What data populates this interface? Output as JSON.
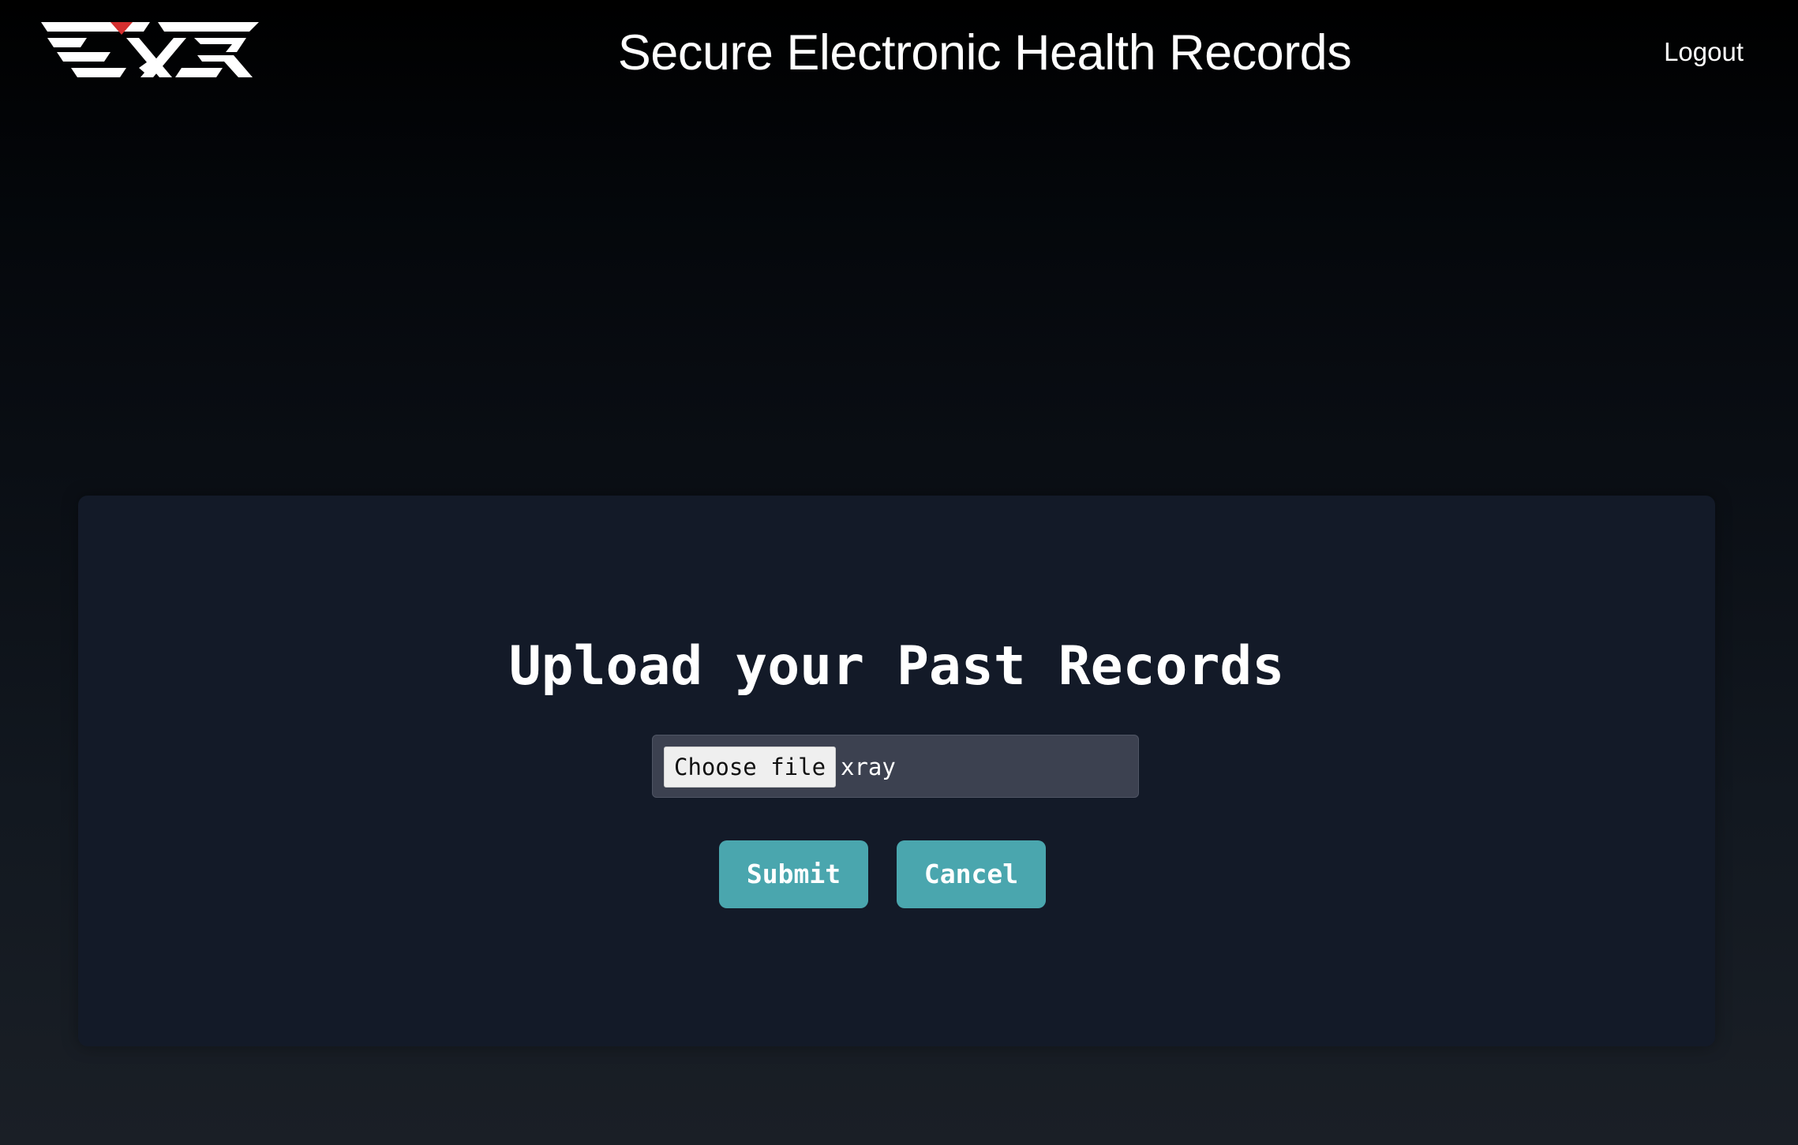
{
  "header": {
    "logo_name": "logo",
    "title": "Secure Electronic Health Records",
    "logout_label": "Logout"
  },
  "upload_card": {
    "title": "Upload your Past Records",
    "file_input": {
      "button_label": "Choose file",
      "selected_file": "xray"
    },
    "submit_label": "Submit",
    "cancel_label": "Cancel"
  },
  "colors": {
    "accent_button": "#4aa6ae",
    "card_background": "#131a28",
    "logo_accent": "#d32f2f"
  }
}
